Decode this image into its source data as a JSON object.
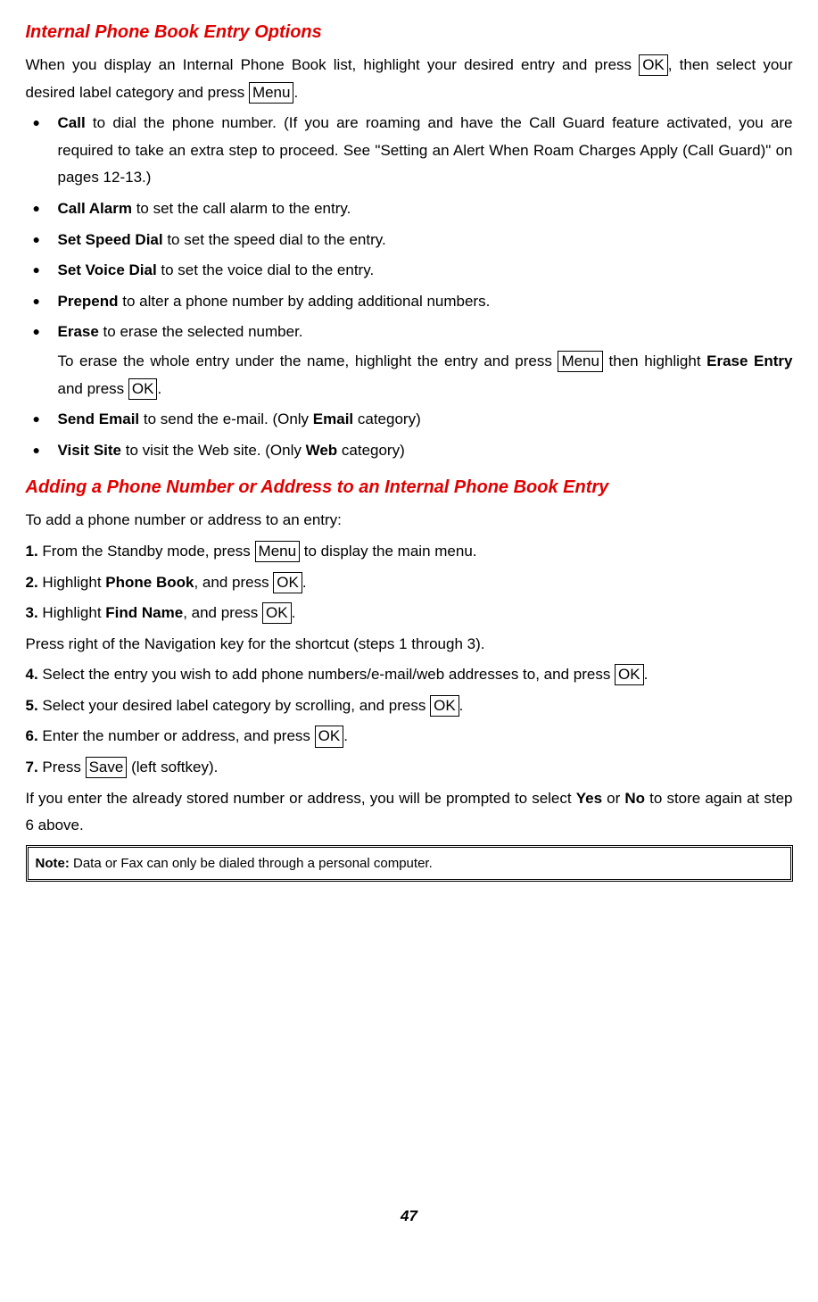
{
  "h1": "Internal Phone Book Entry Options",
  "intro_a": "When you display an Internal Phone Book list, highlight your desired entry and press ",
  "intro_b": ", then select your desired label category and press ",
  "btn_ok": "OK",
  "btn_menu": "Menu",
  "btn_save": "Save",
  "period": ".",
  "li1_b": "Call",
  "li1_t": " to dial the phone number. (If you are roaming and have the Call Guard feature activated, you are required to take an extra step to proceed. See \"Setting an Alert When Roam Charges Apply (Call Guard)\" on pages 12-13.)",
  "li2_b": "Call Alarm",
  "li2_t": " to set the call alarm to the entry.",
  "li3_b": "Set Speed Dial",
  "li3_t": " to set the speed dial to the entry.",
  "li4_b": "Set Voice Dial",
  "li4_t": " to set the voice dial to the entry.",
  "li5_b": "Prepend",
  "li5_t": " to alter a phone number by adding additional numbers.",
  "li6_b": "Erase",
  "li6_t": " to erase the selected number.",
  "li6s_a": "To erase the whole entry under the name, highlight the entry and press ",
  "li6s_b": " then highlight ",
  "li6s_bold": "Erase Entry",
  "li6s_c": " and press ",
  "li7_b": "Send Email",
  "li7_t1": " to send the e-mail. (Only ",
  "li7_bold": "Email",
  "li7_t2": " category)",
  "li8_b": "Visit Site",
  "li8_t1": " to visit the Web site. (Only ",
  "li8_bold": "Web",
  "li8_t2": " category)",
  "h2": "Adding a Phone Number or Address to an Internal Phone Book Entry",
  "p2_intro": "To add a phone number or address to an entry:",
  "s1_n": "1.",
  "s1_a": " From the Standby mode, press ",
  "s1_b": " to display the main menu.",
  "s2_n": "2.",
  "s2_a": " Highlight ",
  "s2_bold": "Phone Book",
  "s2_b": ", and press ",
  "s3_n": "3.",
  "s3_a": " Highlight ",
  "s3_bold": "Find Name",
  "s3_b": ", and press ",
  "shortcut": "Press right of the Navigation key for the shortcut (steps 1 through 3).",
  "s4_n": "4.",
  "s4_a": " Select the entry you wish to add phone numbers/e-mail/web addresses to, and press ",
  "s5_n": "5.",
  "s5_a": " Select your desired label category by scrolling, and press ",
  "s6_n": "6.",
  "s6_a": " Enter the number or address, and press ",
  "s7_n": "7.",
  "s7_a": " Press ",
  "s7_b": " (left softkey).",
  "tail_a": "If you enter the already stored number or address, you will be prompted to select ",
  "tail_yes": "Yes",
  "tail_or": " or ",
  "tail_no": "No",
  "tail_b": " to store again at step 6 above.",
  "note_b": "Note:",
  "note_t": " Data or Fax can only be dialed through a personal computer.",
  "pagenum": "47"
}
